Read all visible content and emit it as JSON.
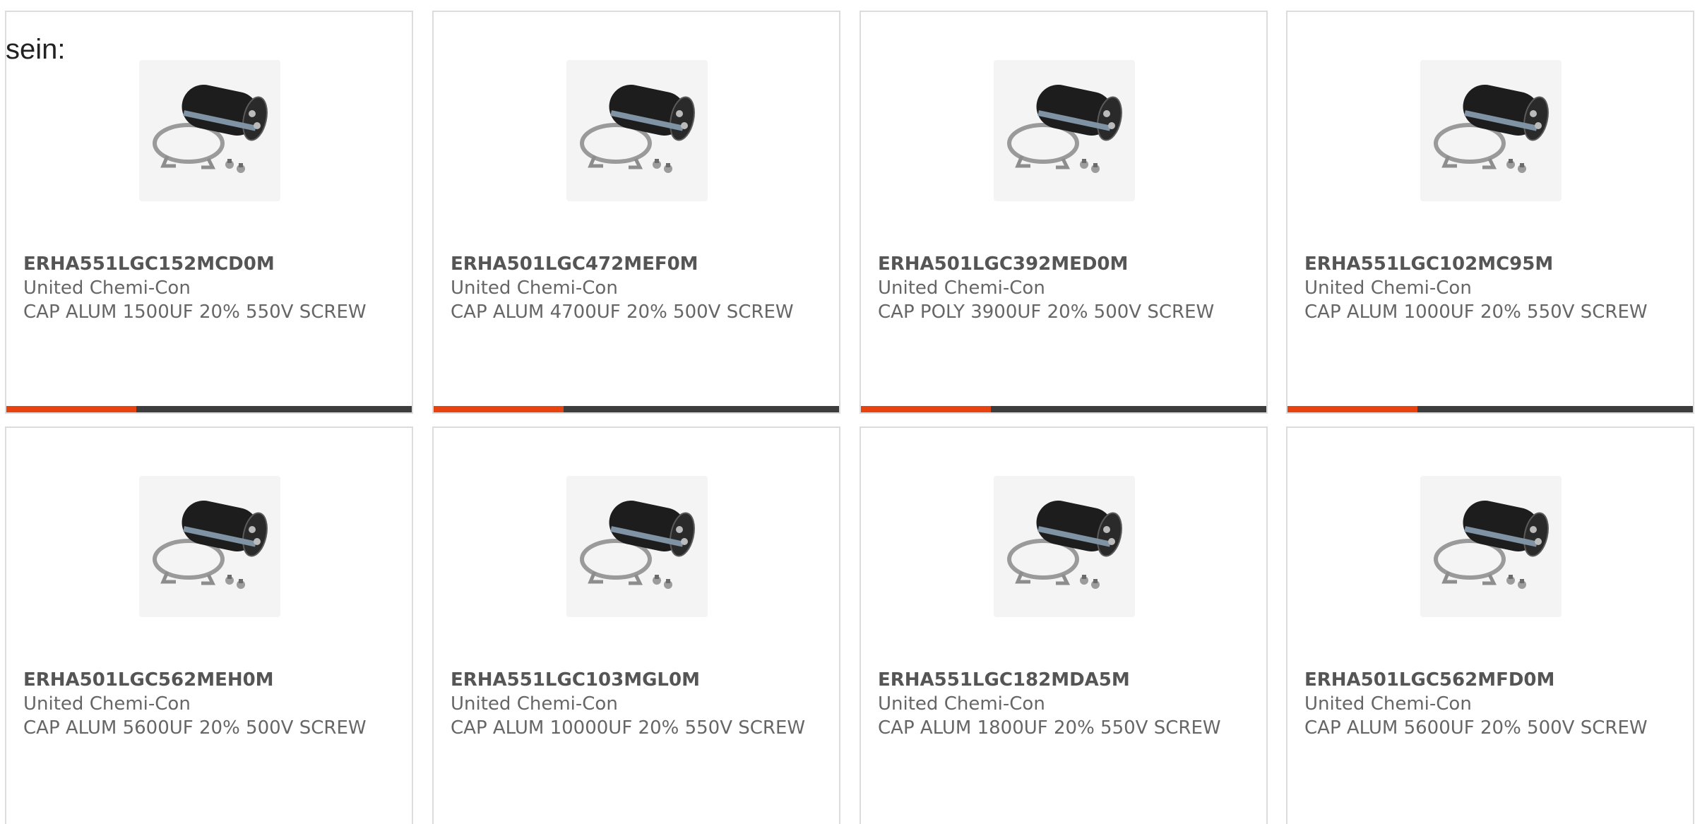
{
  "intro_text": "sein:",
  "accent_color": "#e8420e",
  "bar_color": "#3d3d3d",
  "products": [
    {
      "part": "ERHA551LGC152MCD0M",
      "manufacturer": "United Chemi-Con",
      "description": "CAP ALUM 1500UF 20% 550V SCREW",
      "image": "capacitor-image",
      "accent_fraction": 0.32
    },
    {
      "part": "ERHA501LGC472MEF0M",
      "manufacturer": "United Chemi-Con",
      "description": "CAP ALUM 4700UF 20% 500V SCREW",
      "image": "capacitor-image",
      "accent_fraction": 0.32
    },
    {
      "part": "ERHA501LGC392MED0M",
      "manufacturer": "United Chemi-Con",
      "description": "CAP POLY 3900UF 20% 500V SCREW",
      "image": "capacitor-image",
      "accent_fraction": 0.32
    },
    {
      "part": "ERHA551LGC102MC95M",
      "manufacturer": "United Chemi-Con",
      "description": "CAP ALUM 1000UF 20% 550V SCREW",
      "image": "capacitor-image",
      "accent_fraction": 0.32
    },
    {
      "part": "ERHA501LGC562MEH0M",
      "manufacturer": "United Chemi-Con",
      "description": "CAP ALUM 5600UF 20% 500V SCREW",
      "image": "capacitor-image"
    },
    {
      "part": "ERHA551LGC103MGL0M",
      "manufacturer": "United Chemi-Con",
      "description": "CAP ALUM 10000UF 20% 550V SCREW",
      "image": "capacitor-image"
    },
    {
      "part": "ERHA551LGC182MDA5M",
      "manufacturer": "United Chemi-Con",
      "description": "CAP ALUM 1800UF 20% 550V SCREW",
      "image": "capacitor-image"
    },
    {
      "part": "ERHA501LGC562MFD0M",
      "manufacturer": "United Chemi-Con",
      "description": "CAP ALUM 5600UF 20% 500V SCREW",
      "image": "capacitor-image"
    }
  ]
}
